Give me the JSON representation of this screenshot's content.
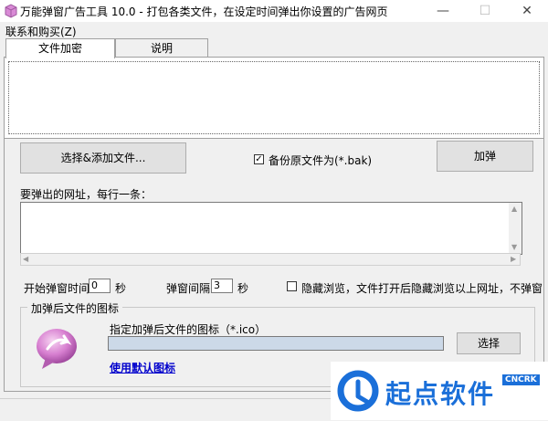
{
  "window": {
    "title": "万能弹窗广告工具 10.0 - 打包各类文件，在设定时间弹出你设置的广告网页",
    "minimize": "—",
    "maximize": "☐",
    "close": "✕"
  },
  "menu": {
    "items": [
      "联系和购买(Z)"
    ]
  },
  "tabs": [
    {
      "label": "文件加密",
      "active": true
    },
    {
      "label": "说明",
      "active": false
    }
  ],
  "toolbar": {
    "select_files": "选择&添加文件...",
    "backup_checked": true,
    "backup_label": "备份原文件为(*.bak)",
    "add_popup": "加弹"
  },
  "url_section": {
    "label": "要弹出的网址，每行一条：",
    "value": ""
  },
  "timing": {
    "start_label": "开始弹窗时间",
    "start_value": "0",
    "start_unit": "秒",
    "interval_label": "弹窗间隔",
    "interval_value": "3",
    "interval_unit": "秒",
    "hidden_checked": false,
    "hidden_label": "隐藏浏览，文件打开后隐藏浏览以上网址，不弹窗"
  },
  "icon_group": {
    "title": "加弹后文件的图标",
    "field_label": "指定加弹后文件的图标（*.ico）",
    "field_value": "",
    "choose_button": "选择",
    "default_link": "使用默认图标"
  },
  "watermark": {
    "text": "起点软件",
    "sub": "CNCRK"
  },
  "colors": {
    "accent": "#1a6fd9",
    "link": "#0000cc",
    "icon_field": "#ccd9e8"
  }
}
